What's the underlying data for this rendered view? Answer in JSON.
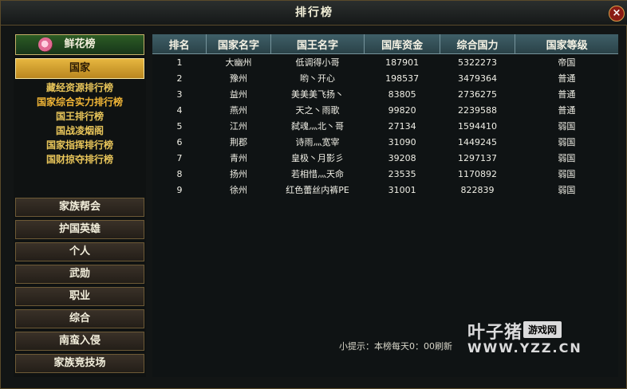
{
  "window": {
    "title": "排行榜",
    "close_label": "×"
  },
  "sidebar": {
    "flower_label": "鲜花榜",
    "country_label": "国家",
    "country_submenu": [
      "藏经资源排行榜",
      "国家综合实力排行榜",
      "国王排行榜",
      "国战凌烟阁",
      "国家指挥排行榜",
      "国财掠夺排行榜"
    ],
    "buttons": [
      "家族帮会",
      "护国英雄",
      "个人",
      "武勋",
      "职业",
      "综合",
      "南蛮入侵",
      "家族竞技场"
    ]
  },
  "table": {
    "headers": [
      "排名",
      "国家名字",
      "国王名字",
      "国库资金",
      "综合国力",
      "国家等级"
    ],
    "rows": [
      [
        "1",
        "大幽州",
        "低调得小哥",
        "187901",
        "5322273",
        "帝国"
      ],
      [
        "2",
        "豫州",
        "哟丶开心",
        "198537",
        "3479364",
        "普通"
      ],
      [
        "3",
        "益州",
        "美美美飞扬丶",
        "83805",
        "2736275",
        "普通"
      ],
      [
        "4",
        "燕州",
        "天之丶雨歌",
        "99820",
        "2239588",
        "普通"
      ],
      [
        "5",
        "江州",
        "弑魂灬北丶哥",
        "27134",
        "1594410",
        "弱国"
      ],
      [
        "6",
        "荆郡",
        "诗雨灬宽宰",
        "31090",
        "1449245",
        "弱国"
      ],
      [
        "7",
        "青州",
        "皇极丶月影彡",
        "39208",
        "1297137",
        "弱国"
      ],
      [
        "8",
        "扬州",
        "若相惜灬天命",
        "23535",
        "1170892",
        "弱国"
      ],
      [
        "9",
        "徐州",
        "红色蕾丝内裤PE",
        "31001",
        "822839",
        "弱国"
      ]
    ]
  },
  "tip": "小提示：本榜每天0：00刷新",
  "watermark": {
    "brand": "叶子猪",
    "tag": "游戏网",
    "url": "WWW.YZZ.CN"
  }
}
